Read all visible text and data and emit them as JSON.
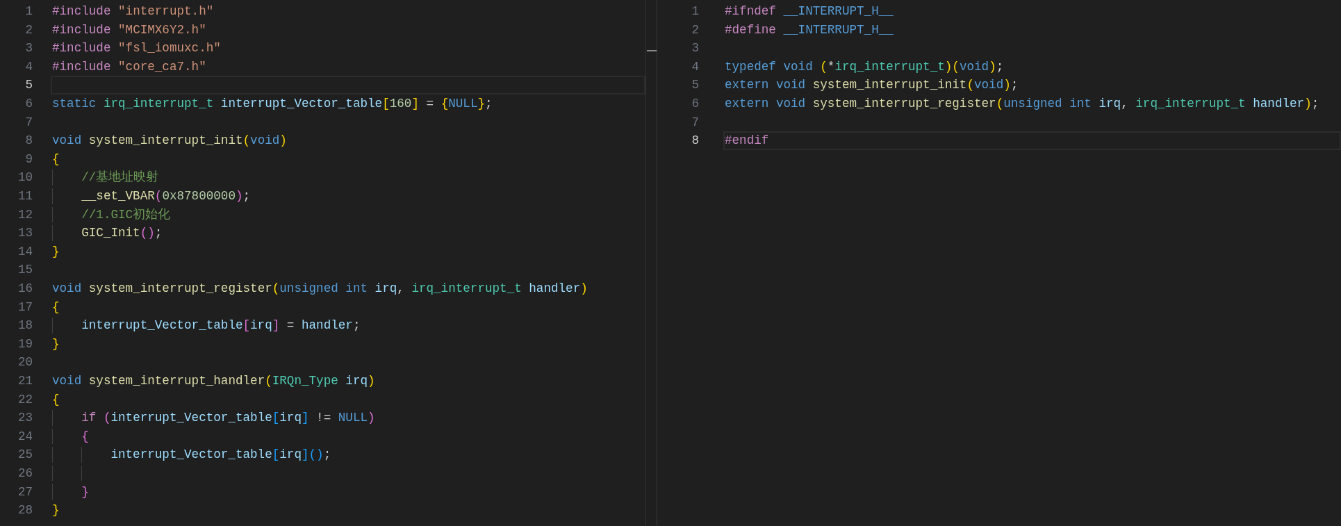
{
  "editor_groups": [
    {
      "lines": [
        {
          "number": "1",
          "current": false,
          "tokens": [
            {
              "text": "#include",
              "kind": "preproc"
            },
            {
              "text": " \"interrupt.h\"",
              "kind": "string"
            }
          ]
        },
        {
          "number": "2",
          "current": false,
          "tokens": [
            {
              "text": "#include",
              "kind": "preproc"
            },
            {
              "text": " \"MCIMX6Y2.h\"",
              "kind": "string"
            }
          ]
        },
        {
          "number": "3",
          "current": false,
          "tokens": [
            {
              "text": "#include",
              "kind": "preproc"
            },
            {
              "text": " \"fsl_iomuxc.h\"",
              "kind": "string"
            }
          ]
        },
        {
          "number": "4",
          "current": false,
          "tokens": [
            {
              "text": "#include",
              "kind": "preproc"
            },
            {
              "text": " \"core_ca7.h\"",
              "kind": "string"
            }
          ]
        },
        {
          "number": "5",
          "current": true
        },
        {
          "number": "6",
          "current": false,
          "tokens": [
            {
              "text": "static",
              "kind": "keyword"
            },
            {
              "text": " irq_interrupt_t",
              "kind": "type"
            },
            {
              "text": " interrupt_Vector_table",
              "kind": "variable"
            },
            {
              "text": "[",
              "kind": "bracket1"
            },
            {
              "text": "160",
              "kind": "number"
            },
            {
              "text": "]",
              "kind": "bracket1"
            },
            {
              "text": " = ",
              "kind": "plain"
            },
            {
              "text": "{",
              "kind": "bracket1"
            },
            {
              "text": "NULL",
              "kind": "keyword"
            },
            {
              "text": "}",
              "kind": "bracket1"
            },
            {
              "text": ";",
              "kind": "plain"
            }
          ]
        },
        {
          "number": "7",
          "current": false
        },
        {
          "number": "8",
          "current": false,
          "tokens": [
            {
              "text": "void",
              "kind": "keyword"
            },
            {
              "text": " system_interrupt_init",
              "kind": "function"
            },
            {
              "text": "(",
              "kind": "bracket1"
            },
            {
              "text": "void",
              "kind": "keyword"
            },
            {
              "text": ")",
              "kind": "bracket1"
            }
          ]
        },
        {
          "number": "9",
          "current": false,
          "tokens": [
            {
              "text": "{",
              "kind": "bracket1"
            }
          ]
        },
        {
          "number": "10",
          "current": false,
          "indent_guides": [
            {
              "active": false
            }
          ],
          "tokens": [
            {
              "text": "//基地址映射",
              "kind": "comment"
            }
          ]
        },
        {
          "number": "11",
          "current": false,
          "indent_guides": [
            {
              "active": false
            }
          ],
          "tokens": [
            {
              "text": "__set_VBAR",
              "kind": "function"
            },
            {
              "text": "(",
              "kind": "bracket2"
            },
            {
              "text": "0x87800000",
              "kind": "number"
            },
            {
              "text": ")",
              "kind": "bracket2"
            },
            {
              "text": ";",
              "kind": "plain"
            }
          ]
        },
        {
          "number": "12",
          "current": false,
          "indent_guides": [
            {
              "active": false
            }
          ],
          "tokens": [
            {
              "text": "//1.GIC初始化",
              "kind": "comment"
            }
          ]
        },
        {
          "number": "13",
          "current": false,
          "indent_guides": [
            {
              "active": false
            }
          ],
          "tokens": [
            {
              "text": "GIC_Init",
              "kind": "function"
            },
            {
              "text": "()",
              "kind": "bracket2"
            },
            {
              "text": ";",
              "kind": "plain"
            }
          ]
        },
        {
          "number": "14",
          "current": false,
          "tokens": [
            {
              "text": "}",
              "kind": "bracket1"
            }
          ]
        },
        {
          "number": "15",
          "current": false
        },
        {
          "number": "16",
          "current": false,
          "tokens": [
            {
              "text": "void",
              "kind": "keyword"
            },
            {
              "text": " system_interrupt_register",
              "kind": "function"
            },
            {
              "text": "(",
              "kind": "bracket1"
            },
            {
              "text": "unsigned int",
              "kind": "keyword"
            },
            {
              "text": " irq",
              "kind": "variable"
            },
            {
              "text": ", ",
              "kind": "plain"
            },
            {
              "text": "irq_interrupt_t",
              "kind": "type"
            },
            {
              "text": " handler",
              "kind": "variable"
            },
            {
              "text": ")",
              "kind": "bracket1"
            }
          ]
        },
        {
          "number": "17",
          "current": false,
          "tokens": [
            {
              "text": "{",
              "kind": "bracket1"
            }
          ]
        },
        {
          "number": "18",
          "current": false,
          "indent_guides": [
            {
              "active": false
            }
          ],
          "tokens": [
            {
              "text": "interrupt_Vector_table",
              "kind": "variable"
            },
            {
              "text": "[",
              "kind": "bracket2"
            },
            {
              "text": "irq",
              "kind": "variable"
            },
            {
              "text": "]",
              "kind": "bracket2"
            },
            {
              "text": " = ",
              "kind": "plain"
            },
            {
              "text": "handler",
              "kind": "variable"
            },
            {
              "text": ";",
              "kind": "plain"
            }
          ]
        },
        {
          "number": "19",
          "current": false,
          "tokens": [
            {
              "text": "}",
              "kind": "bracket1"
            }
          ]
        },
        {
          "number": "20",
          "current": false
        },
        {
          "number": "21",
          "current": false,
          "tokens": [
            {
              "text": "void",
              "kind": "keyword"
            },
            {
              "text": " system_interrupt_handler",
              "kind": "function"
            },
            {
              "text": "(",
              "kind": "bracket1"
            },
            {
              "text": "IRQn_Type",
              "kind": "type"
            },
            {
              "text": " irq",
              "kind": "variable"
            },
            {
              "text": ")",
              "kind": "bracket1"
            }
          ]
        },
        {
          "number": "22",
          "current": false,
          "tokens": [
            {
              "text": "{",
              "kind": "bracket1"
            }
          ]
        },
        {
          "number": "23",
          "current": false,
          "indent_guides": [
            {
              "active": false
            }
          ],
          "tokens": [
            {
              "text": "if ",
              "kind": "control"
            },
            {
              "text": "(",
              "kind": "bracket2"
            },
            {
              "text": "interrupt_Vector_table",
              "kind": "variable"
            },
            {
              "text": "[",
              "kind": "bracket3"
            },
            {
              "text": "irq",
              "kind": "variable"
            },
            {
              "text": "]",
              "kind": "bracket3"
            },
            {
              "text": " != ",
              "kind": "plain"
            },
            {
              "text": "NULL",
              "kind": "keyword"
            },
            {
              "text": ")",
              "kind": "bracket2"
            }
          ]
        },
        {
          "number": "24",
          "current": false,
          "indent_guides": [
            {
              "active": false
            }
          ],
          "tokens": [
            {
              "text": "{",
              "kind": "bracket2"
            }
          ]
        },
        {
          "number": "25",
          "current": false,
          "indent_guides": [
            {
              "active": false
            },
            {
              "active": false
            }
          ],
          "tokens": [
            {
              "text": "interrupt_Vector_table",
              "kind": "variable"
            },
            {
              "text": "[",
              "kind": "bracket3"
            },
            {
              "text": "irq",
              "kind": "variable"
            },
            {
              "text": "]",
              "kind": "bracket3"
            },
            {
              "text": "()",
              "kind": "bracket3"
            },
            {
              "text": ";",
              "kind": "plain"
            }
          ]
        },
        {
          "number": "26",
          "current": false,
          "indent_guides": [
            {
              "active": false
            },
            {
              "active": false
            }
          ]
        },
        {
          "number": "27",
          "current": false,
          "indent_guides": [
            {
              "active": false
            }
          ],
          "tokens": [
            {
              "text": "}",
              "kind": "bracket2"
            }
          ]
        },
        {
          "number": "28",
          "current": false,
          "tokens": [
            {
              "text": "}",
              "kind": "bracket1"
            }
          ]
        }
      ]
    },
    {
      "lines": [
        {
          "number": "1",
          "current": false,
          "tokens": [
            {
              "text": "#ifndef",
              "kind": "preproc"
            },
            {
              "text": " __INTERRUPT_H__",
              "kind": "macro"
            }
          ]
        },
        {
          "number": "2",
          "current": false,
          "tokens": [
            {
              "text": "#define",
              "kind": "preproc"
            },
            {
              "text": " __INTERRUPT_H__",
              "kind": "macro"
            }
          ]
        },
        {
          "number": "3",
          "current": false
        },
        {
          "number": "4",
          "current": false,
          "tokens": [
            {
              "text": "typedef void ",
              "kind": "keyword"
            },
            {
              "text": "(",
              "kind": "bracket1"
            },
            {
              "text": "*",
              "kind": "plain"
            },
            {
              "text": "irq_interrupt_t",
              "kind": "type"
            },
            {
              "text": ")",
              "kind": "bracket1"
            },
            {
              "text": "(",
              "kind": "bracket1"
            },
            {
              "text": "void",
              "kind": "keyword"
            },
            {
              "text": ")",
              "kind": "bracket1"
            },
            {
              "text": ";",
              "kind": "plain"
            }
          ]
        },
        {
          "number": "5",
          "current": false,
          "tokens": [
            {
              "text": "extern void",
              "kind": "keyword"
            },
            {
              "text": " system_interrupt_init",
              "kind": "function"
            },
            {
              "text": "(",
              "kind": "bracket1"
            },
            {
              "text": "void",
              "kind": "keyword"
            },
            {
              "text": ")",
              "kind": "bracket1"
            },
            {
              "text": ";",
              "kind": "plain"
            }
          ]
        },
        {
          "number": "6",
          "current": false,
          "tokens": [
            {
              "text": "extern void",
              "kind": "keyword"
            },
            {
              "text": " system_interrupt_register",
              "kind": "function"
            },
            {
              "text": "(",
              "kind": "bracket1"
            },
            {
              "text": "unsigned int",
              "kind": "keyword"
            },
            {
              "text": " irq",
              "kind": "variable"
            },
            {
              "text": ", ",
              "kind": "plain"
            },
            {
              "text": "irq_interrupt_t",
              "kind": "type"
            },
            {
              "text": " handler",
              "kind": "variable"
            },
            {
              "text": ")",
              "kind": "bracket1"
            },
            {
              "text": ";",
              "kind": "plain"
            }
          ]
        },
        {
          "number": "7",
          "current": false
        },
        {
          "number": "8",
          "current": true,
          "tokens": [
            {
              "text": "#endif",
              "kind": "preproc"
            }
          ]
        }
      ]
    }
  ]
}
